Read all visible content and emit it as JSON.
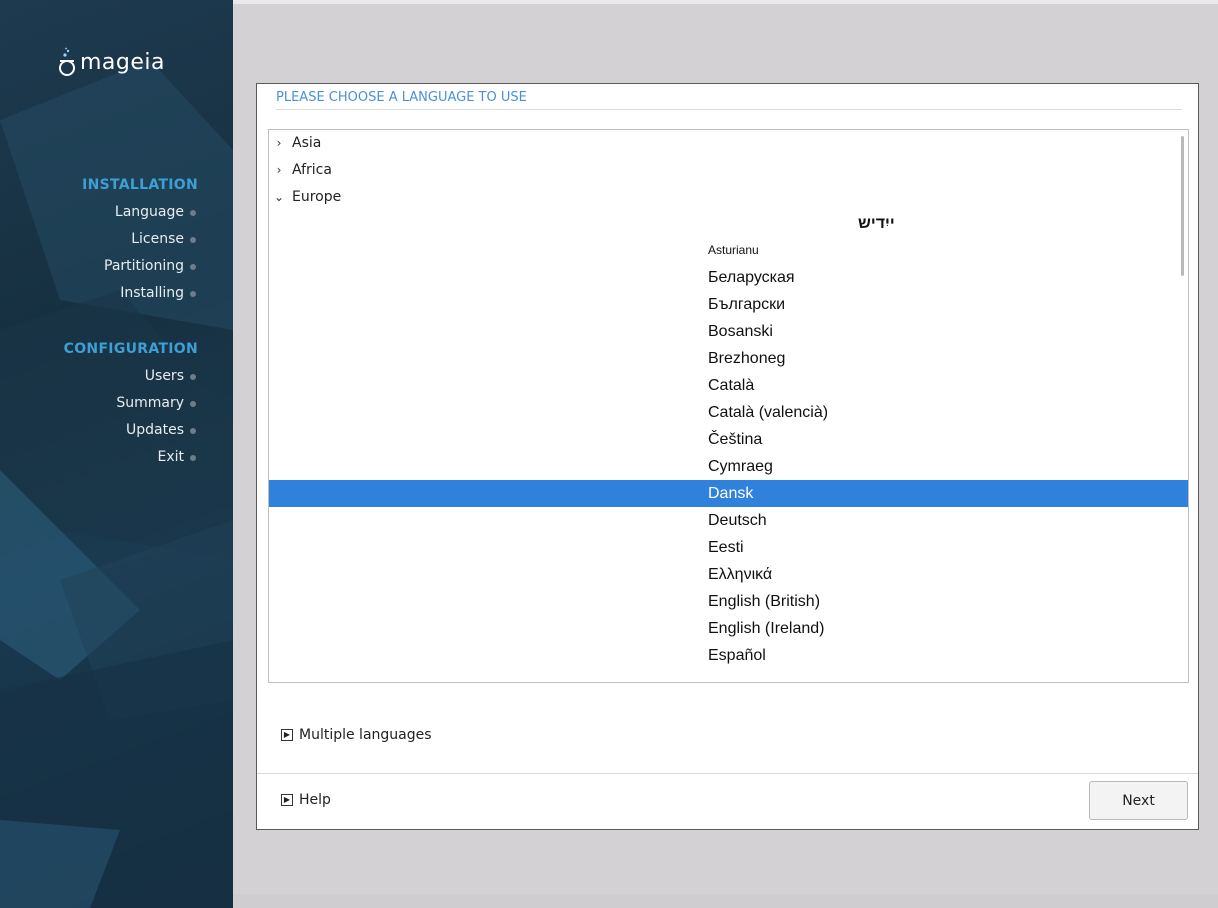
{
  "sidebar": {
    "brand": "mageia",
    "sections": [
      {
        "title": "INSTALLATION",
        "steps": [
          "Language",
          "License",
          "Partitioning",
          "Installing"
        ]
      },
      {
        "title": "CONFIGURATION",
        "steps": [
          "Users",
          "Summary",
          "Updates",
          "Exit"
        ]
      }
    ]
  },
  "panel": {
    "title": "PLEASE CHOOSE A LANGUAGE TO USE",
    "regions": [
      {
        "label": "Asia",
        "expanded": false
      },
      {
        "label": "Africa",
        "expanded": false
      },
      {
        "label": "Europe",
        "expanded": true
      }
    ],
    "languages": [
      "ייִדיש",
      "Asturianu",
      "Беларуская",
      "Български",
      "Bosanski",
      "Brezhoneg",
      "Català",
      "Català (valencià)",
      "Čeština",
      "Cymraeg",
      "Dansk",
      "Deutsch",
      "Eesti",
      "Ελληνικά",
      "English (British)",
      "English (Ireland)",
      "Español"
    ],
    "selected_language": "Dansk",
    "multiple_languages_label": "Multiple languages",
    "help_label": "Help",
    "next_label": "Next"
  },
  "colors": {
    "accent": "#3d9fd4",
    "title_blue": "#4a90d9",
    "selection": "#2f81dc"
  }
}
